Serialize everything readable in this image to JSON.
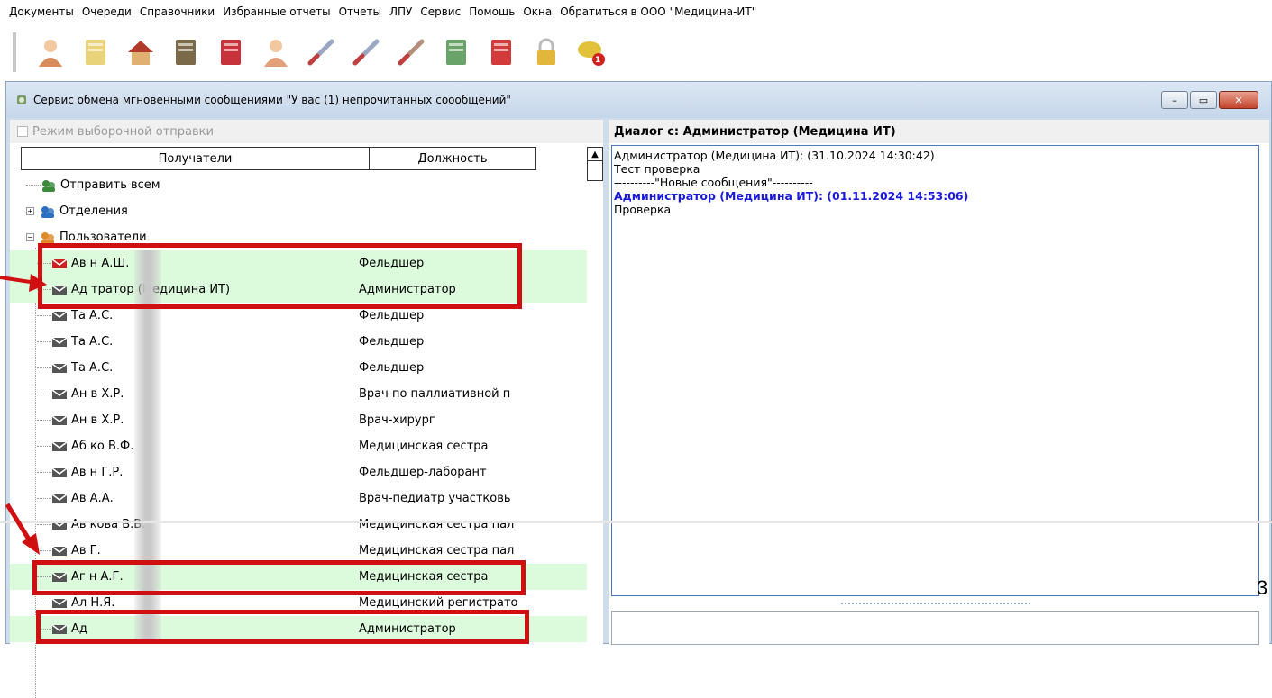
{
  "menu": [
    "Документы",
    "Очереди",
    "Справочники",
    "Избранные отчеты",
    "Отчеты",
    "ЛПУ",
    "Сервис",
    "Помощь",
    "Окна",
    "Обратиться в ООО \"Медицина-ИТ\""
  ],
  "toolbar_icons": [
    "patient-icon",
    "journal-icon",
    "house-icon",
    "archive-icon",
    "book-icon",
    "nurse-icon",
    "syringe-icon",
    "thermometer-icon",
    "thermometer-2-icon",
    "calculator-icon",
    "report-icon",
    "lock-icon",
    "chat-icon"
  ],
  "toolbar_badge": "1",
  "window": {
    "title": "Сервис обмена мгновенными сообщениями \"У вас (1) непрочитанных сооoбщений\"",
    "controls": [
      "–",
      "▭",
      "✕"
    ]
  },
  "left": {
    "mode_label": "Режим выборочной отправки",
    "col_recipients": "Получатели",
    "col_position": "Должность",
    "tree": [
      {
        "name": "Отправить всем",
        "position": "",
        "kind": "all",
        "highlight": false
      },
      {
        "name": "Отделения",
        "position": "",
        "kind": "dept",
        "highlight": false,
        "expander": "+"
      },
      {
        "name": "Пользователи",
        "position": "",
        "kind": "users",
        "highlight": false,
        "expander": "−"
      },
      {
        "name": "Ав         н А.Ш.",
        "position": "Фельдшер",
        "kind": "mail-red",
        "highlight": true
      },
      {
        "name": "Ад         тратор (Медицина ИТ)",
        "position": "Администратор",
        "kind": "mail",
        "highlight": true
      },
      {
        "name": "Та         А.С.",
        "position": "Фельдшер",
        "kind": "mail",
        "highlight": false
      },
      {
        "name": "Та         А.С.",
        "position": "Фельдшер",
        "kind": "mail",
        "highlight": false
      },
      {
        "name": "Та         А.С.",
        "position": "Фельдшер",
        "kind": "mail",
        "highlight": false
      },
      {
        "name": "Ан         в Х.Р.",
        "position": "Врач по паллиативной п",
        "kind": "mail",
        "highlight": false
      },
      {
        "name": "Ан         в Х.Р.",
        "position": "Врач-хирург",
        "kind": "mail",
        "highlight": false
      },
      {
        "name": "Аб         ко В.Ф.",
        "position": "Медицинская сестра",
        "kind": "mail",
        "highlight": false
      },
      {
        "name": "Ав         н Г.Р.",
        "position": "Фельдшер-лаборант",
        "kind": "mail",
        "highlight": false
      },
      {
        "name": "Ав         А.А.",
        "position": "Врач-педиатр участковь",
        "kind": "mail",
        "highlight": false
      },
      {
        "name": "Ав         кова В.В.",
        "position": "Медицинская сестра пал",
        "kind": "mail",
        "highlight": false
      },
      {
        "name": "Ав         Г.",
        "position": "Медицинская сестра пал",
        "kind": "mail",
        "highlight": false
      },
      {
        "name": "Аг         н А.Г.",
        "position": "Медицинская сестра",
        "kind": "mail",
        "highlight": true
      },
      {
        "name": "Ал         Н.Я.",
        "position": "Медицинский регистрато",
        "kind": "mail",
        "highlight": false
      },
      {
        "name": "Ад",
        "position": "Администратор",
        "kind": "mail",
        "highlight": true
      }
    ]
  },
  "right": {
    "dialog_title": "Диалог с:  Администратор (Медицина ИТ)",
    "messages": [
      {
        "text": "Администратор (Медицина ИТ): (31.10.2024 14:30:42)",
        "style": "normal"
      },
      {
        "text": "Тест проверка",
        "style": "normal"
      },
      {
        "text": "----------\"Новые сообщения\"----------",
        "style": "normal"
      },
      {
        "text": "Администратор (Медицина ИТ): (01.11.2024 14:53:06)",
        "style": "blue"
      },
      {
        "text": "Проверка",
        "style": "normal"
      }
    ]
  },
  "page_number": "3",
  "colors": {
    "highlight": "#dcfadc",
    "annotation": "#d01010",
    "new_message": "#1a1adc"
  }
}
